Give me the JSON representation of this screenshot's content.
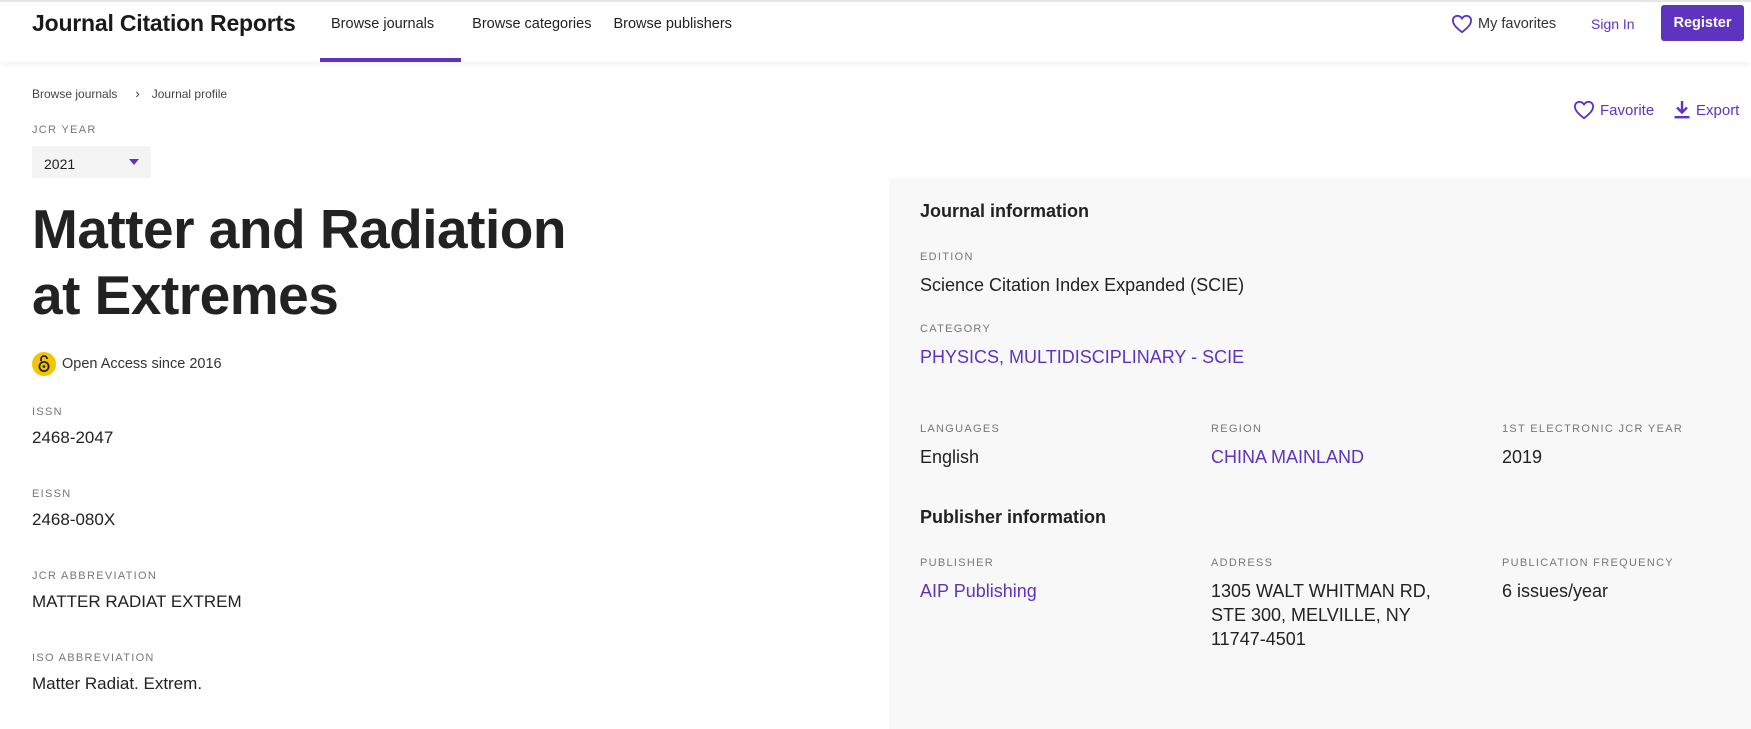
{
  "header": {
    "brand": "Journal Citation Reports",
    "nav": [
      "Browse journals",
      "Browse categories",
      "Browse publishers"
    ],
    "favorites": "My favorites",
    "sign_in": "Sign In",
    "register": "Register"
  },
  "breadcrumb": [
    "Browse journals",
    "Journal profile"
  ],
  "jcr_year": {
    "label": "JCR YEAR",
    "value": "2021"
  },
  "actions": {
    "favorite": "Favorite",
    "export": "Export"
  },
  "journal": {
    "title_line1": "Matter and Radiation",
    "title_line2": "at Extremes",
    "open_access": "Open Access since 2016",
    "fields": [
      {
        "label": "ISSN",
        "value": "2468-2047"
      },
      {
        "label": "EISSN",
        "value": "2468-080X"
      },
      {
        "label": "JCR ABBREVIATION",
        "value": "MATTER RADIAT EXTREM"
      },
      {
        "label": "ISO ABBREVIATION",
        "value": "Matter Radiat. Extrem."
      }
    ]
  },
  "journal_information": {
    "title": "Journal information",
    "edition": {
      "label": "EDITION",
      "value": "Science Citation Index Expanded (SCIE)"
    },
    "category": {
      "label": "CATEGORY",
      "value": "PHYSICS, MULTIDISCIPLINARY - SCIE"
    },
    "languages": {
      "label": "LANGUAGES",
      "value": "English"
    },
    "region": {
      "label": "REGION",
      "value": "CHINA MAINLAND"
    },
    "first_year": {
      "label": "1ST ELECTRONIC JCR YEAR",
      "value": "2019"
    }
  },
  "publisher_information": {
    "title": "Publisher information",
    "publisher": {
      "label": "PUBLISHER",
      "value": "AIP Publishing"
    },
    "address": {
      "label": "ADDRESS",
      "line1": "1305 WALT WHITMAN RD,",
      "line2": "STE 300, MELVILLE, NY",
      "line3": "11747-4501"
    },
    "frequency": {
      "label": "PUBLICATION FREQUENCY",
      "value": "6 issues/year"
    }
  },
  "colors": {
    "accent": "#5e33bf",
    "oa_badge": "#f5c400",
    "panel_bg": "#f8f8f8"
  }
}
